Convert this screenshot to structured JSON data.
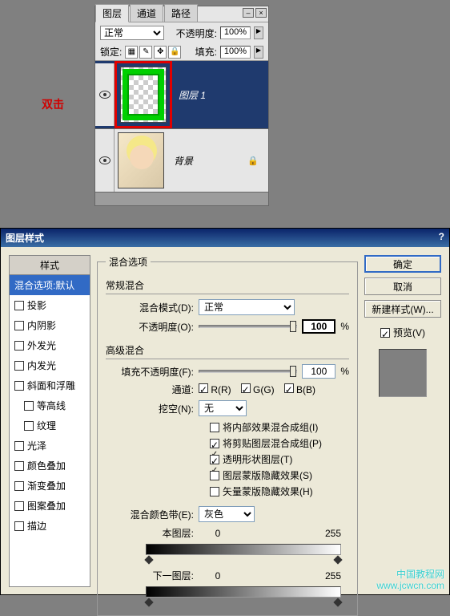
{
  "annotation": "双击",
  "layers_panel": {
    "tabs": [
      "图层",
      "通道",
      "路径"
    ],
    "blend_mode": "正常",
    "opacity_label": "不透明度:",
    "opacity_value": "100%",
    "lock_label": "锁定:",
    "fill_label": "填充:",
    "fill_value": "100%",
    "layers": [
      {
        "name": "图层 1",
        "selected": true,
        "thumb": "frame"
      },
      {
        "name": "背景",
        "selected": false,
        "thumb": "photo",
        "locked": true
      }
    ]
  },
  "dialog": {
    "title": "图层样式",
    "styles_header": "样式",
    "style_items": [
      {
        "label": "混合选项:默认",
        "selected": true,
        "no_check": true
      },
      {
        "label": "投影"
      },
      {
        "label": "内阴影"
      },
      {
        "label": "外发光"
      },
      {
        "label": "内发光"
      },
      {
        "label": "斜面和浮雕"
      },
      {
        "label": "等高线",
        "indent": true
      },
      {
        "label": "纹理",
        "indent": true
      },
      {
        "label": "光泽"
      },
      {
        "label": "颜色叠加"
      },
      {
        "label": "渐变叠加"
      },
      {
        "label": "图案叠加"
      },
      {
        "label": "描边"
      }
    ],
    "main_title": "混合选项",
    "general_group": "常规混合",
    "blend_mode_label": "混合模式(D):",
    "blend_mode_value": "正常",
    "opacity_label": "不透明度(O):",
    "opacity_value": "100",
    "advanced_group": "高级混合",
    "fill_opacity_label": "填充不透明度(F):",
    "fill_opacity_value": "100",
    "channel_label": "通道:",
    "channels": {
      "r": "R(R)",
      "g": "G(G)",
      "b": "B(B)"
    },
    "knockout_label": "挖空(N):",
    "knockout_value": "无",
    "adv_checks": [
      {
        "label": "将内部效果混合成组(I)",
        "checked": false
      },
      {
        "label": "将剪贴图层混合成组(P)",
        "checked": true
      },
      {
        "label": "透明形状图层(T)",
        "checked": true
      },
      {
        "label": "图层蒙版隐藏效果(S)",
        "checked": false
      },
      {
        "label": "矢量蒙版隐藏效果(H)",
        "checked": false
      }
    ],
    "blend_if_label": "混合颜色带(E):",
    "blend_if_value": "灰色",
    "this_layer": "本图层:",
    "underlying": "下一图层:",
    "range_min": "0",
    "range_max": "255",
    "buttons": {
      "ok": "确定",
      "cancel": "取消",
      "new_style": "新建样式(W)..."
    },
    "preview_label": "预览(V)",
    "pct": "%",
    "lock_sym": "🔒"
  },
  "watermark": {
    "line1": "中国教程网",
    "line2": "www.jcwcn.com"
  }
}
